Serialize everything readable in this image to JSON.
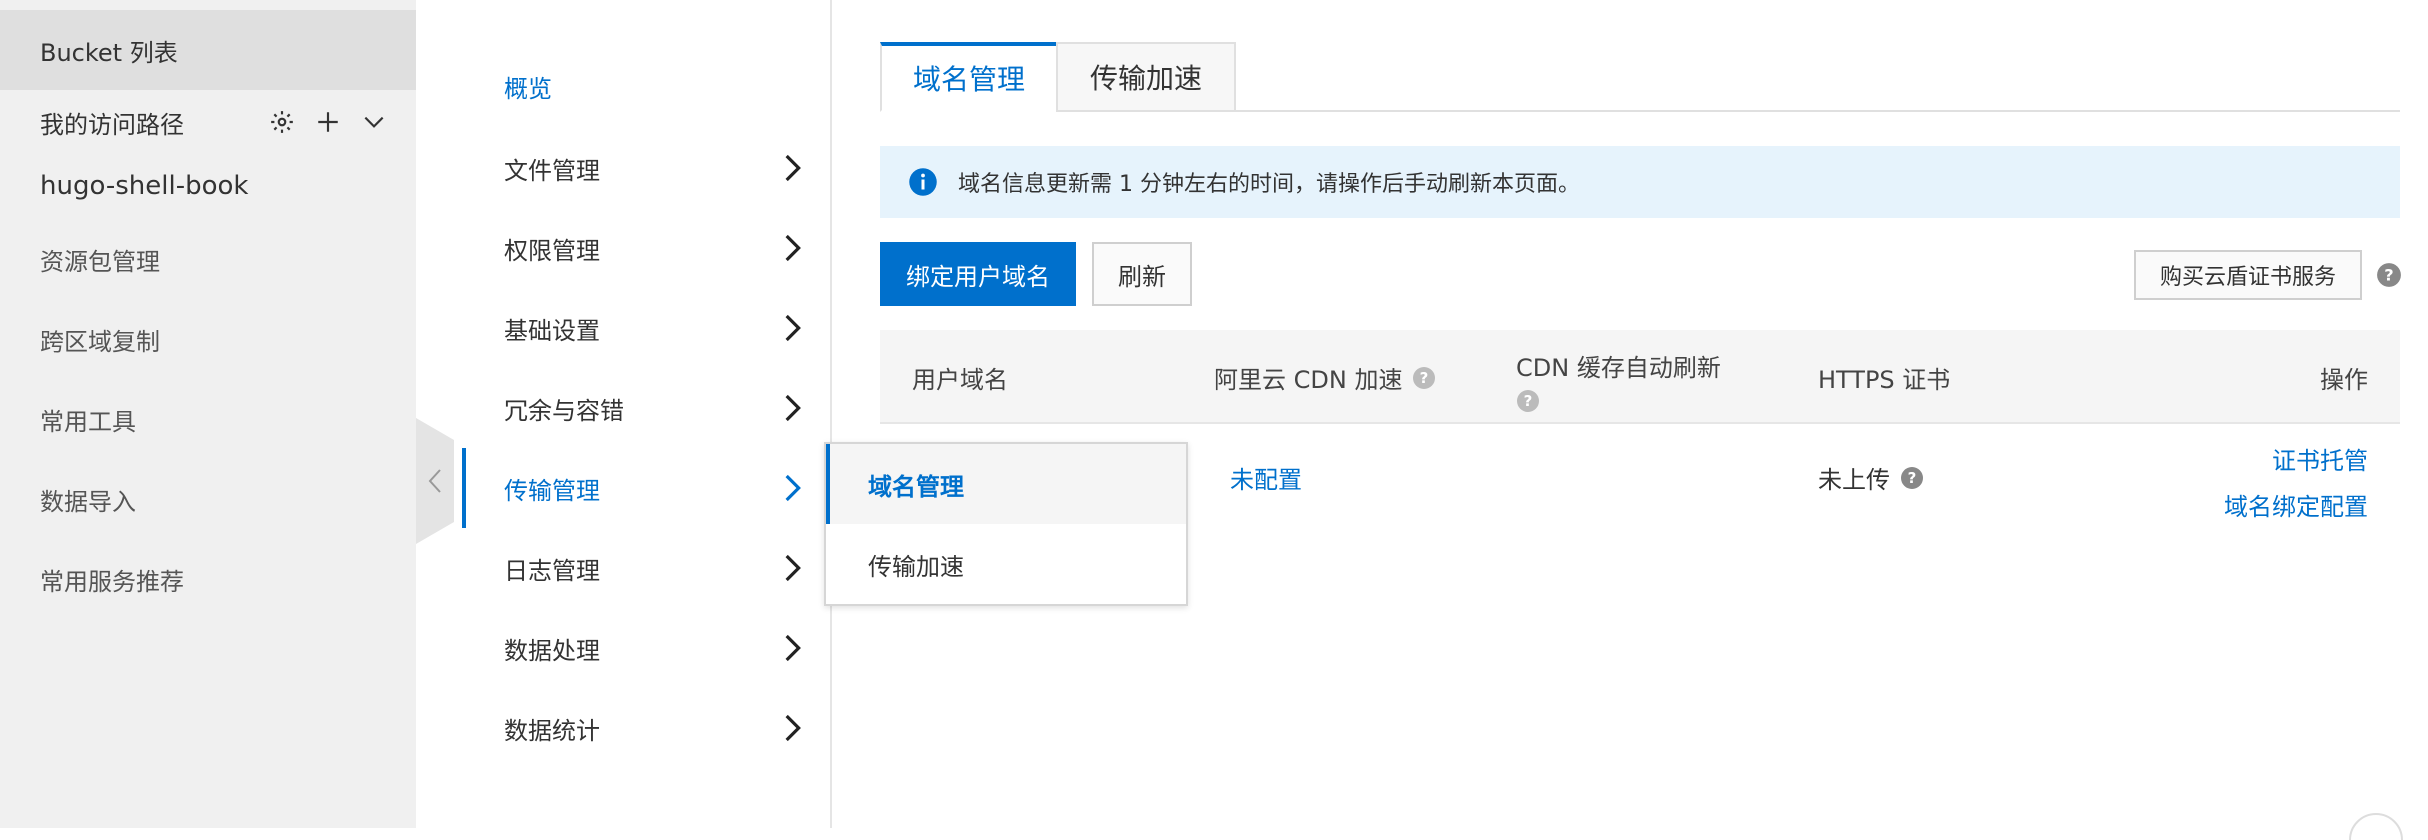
{
  "sidebar": {
    "bucket_list": "Bucket 列表",
    "access_path": "我的访问路径",
    "bucket_name": "hugo-shell-book",
    "items": [
      "资源包管理",
      "跨区域复制",
      "常用工具",
      "数据导入",
      "常用服务推荐"
    ]
  },
  "subnav": {
    "overview": "概览",
    "items": [
      "文件管理",
      "权限管理",
      "基础设置",
      "冗余与容错",
      "传输管理",
      "日志管理",
      "数据处理",
      "数据统计"
    ],
    "selected": "传输管理"
  },
  "flyout": {
    "items": [
      "域名管理",
      "传输加速"
    ],
    "active": "域名管理"
  },
  "tabs": [
    "域名管理",
    "传输加速"
  ],
  "notice": "域名信息更新需 1 分钟左右的时间，请操作后手动刷新本页面。",
  "toolbar": {
    "bind_label": "绑定用户域名",
    "refresh_label": "刷新",
    "buy_cert_label": "购买云盾证书服务"
  },
  "table": {
    "headers": [
      "用户域名",
      "阿里云 CDN 加速",
      "CDN 缓存自动刷新",
      "HTTPS 证书",
      "操作"
    ],
    "rows": [
      {
        "domain": "",
        "cdn": "未配置",
        "auto_refresh": "",
        "https": "未上传",
        "ops": [
          "证书托管",
          "域名绑定配置"
        ]
      }
    ]
  },
  "colors": {
    "accent": "#0070cc",
    "sidebar_bg": "#f0f0f0",
    "notice_bg": "#e6f3fc"
  }
}
